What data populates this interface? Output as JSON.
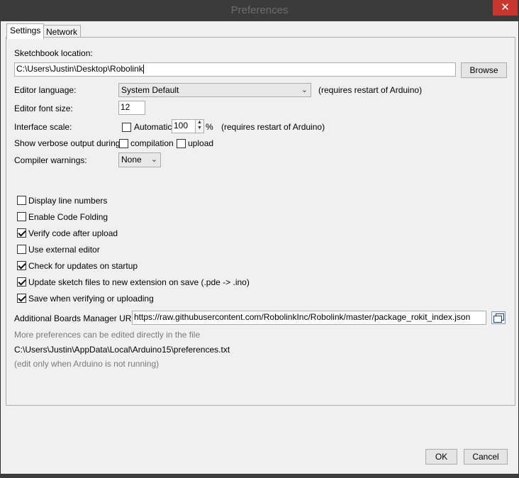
{
  "window": {
    "title": "Preferences",
    "close": "✕"
  },
  "tabs": [
    {
      "label": "Settings"
    },
    {
      "label": "Network"
    }
  ],
  "sketchbook": {
    "label": "Sketchbook location:",
    "value": "C:\\Users\\Justin\\Desktop\\Robolink",
    "browse": "Browse"
  },
  "editor_language": {
    "label": "Editor language:",
    "value": "System Default",
    "note": "(requires restart of Arduino)"
  },
  "editor_font_size": {
    "label": "Editor font size:",
    "value": "12"
  },
  "interface_scale": {
    "label": "Interface scale:",
    "automatic": "Automatic",
    "value": "100",
    "unit": "%",
    "note": "(requires restart of Arduino)"
  },
  "verbose": {
    "label": "Show verbose output during:",
    "compilation": "compilation",
    "upload": "upload"
  },
  "compiler_warnings": {
    "label": "Compiler warnings:",
    "value": "None"
  },
  "options": [
    {
      "label": "Display line numbers",
      "checked": false
    },
    {
      "label": "Enable Code Folding",
      "checked": false
    },
    {
      "label": "Verify code after upload",
      "checked": true
    },
    {
      "label": "Use external editor",
      "checked": false
    },
    {
      "label": "Check for updates on startup",
      "checked": true
    },
    {
      "label": "Update sketch files to new extension on save (.pde -> .ino)",
      "checked": true
    },
    {
      "label": "Save when verifying or uploading",
      "checked": true
    }
  ],
  "boards_manager": {
    "label": "Additional Boards Manager URLs:",
    "value": "https://raw.githubusercontent.com/RobolinkInc/Robolink/master/package_rokit_index.json"
  },
  "more_prefs": {
    "line1": "More preferences can be edited directly in the file",
    "path": "C:\\Users\\Justin\\AppData\\Local\\Arduino15\\preferences.txt",
    "line3": "(edit only when Arduino is not running)"
  },
  "buttons": {
    "ok": "OK",
    "cancel": "Cancel"
  }
}
